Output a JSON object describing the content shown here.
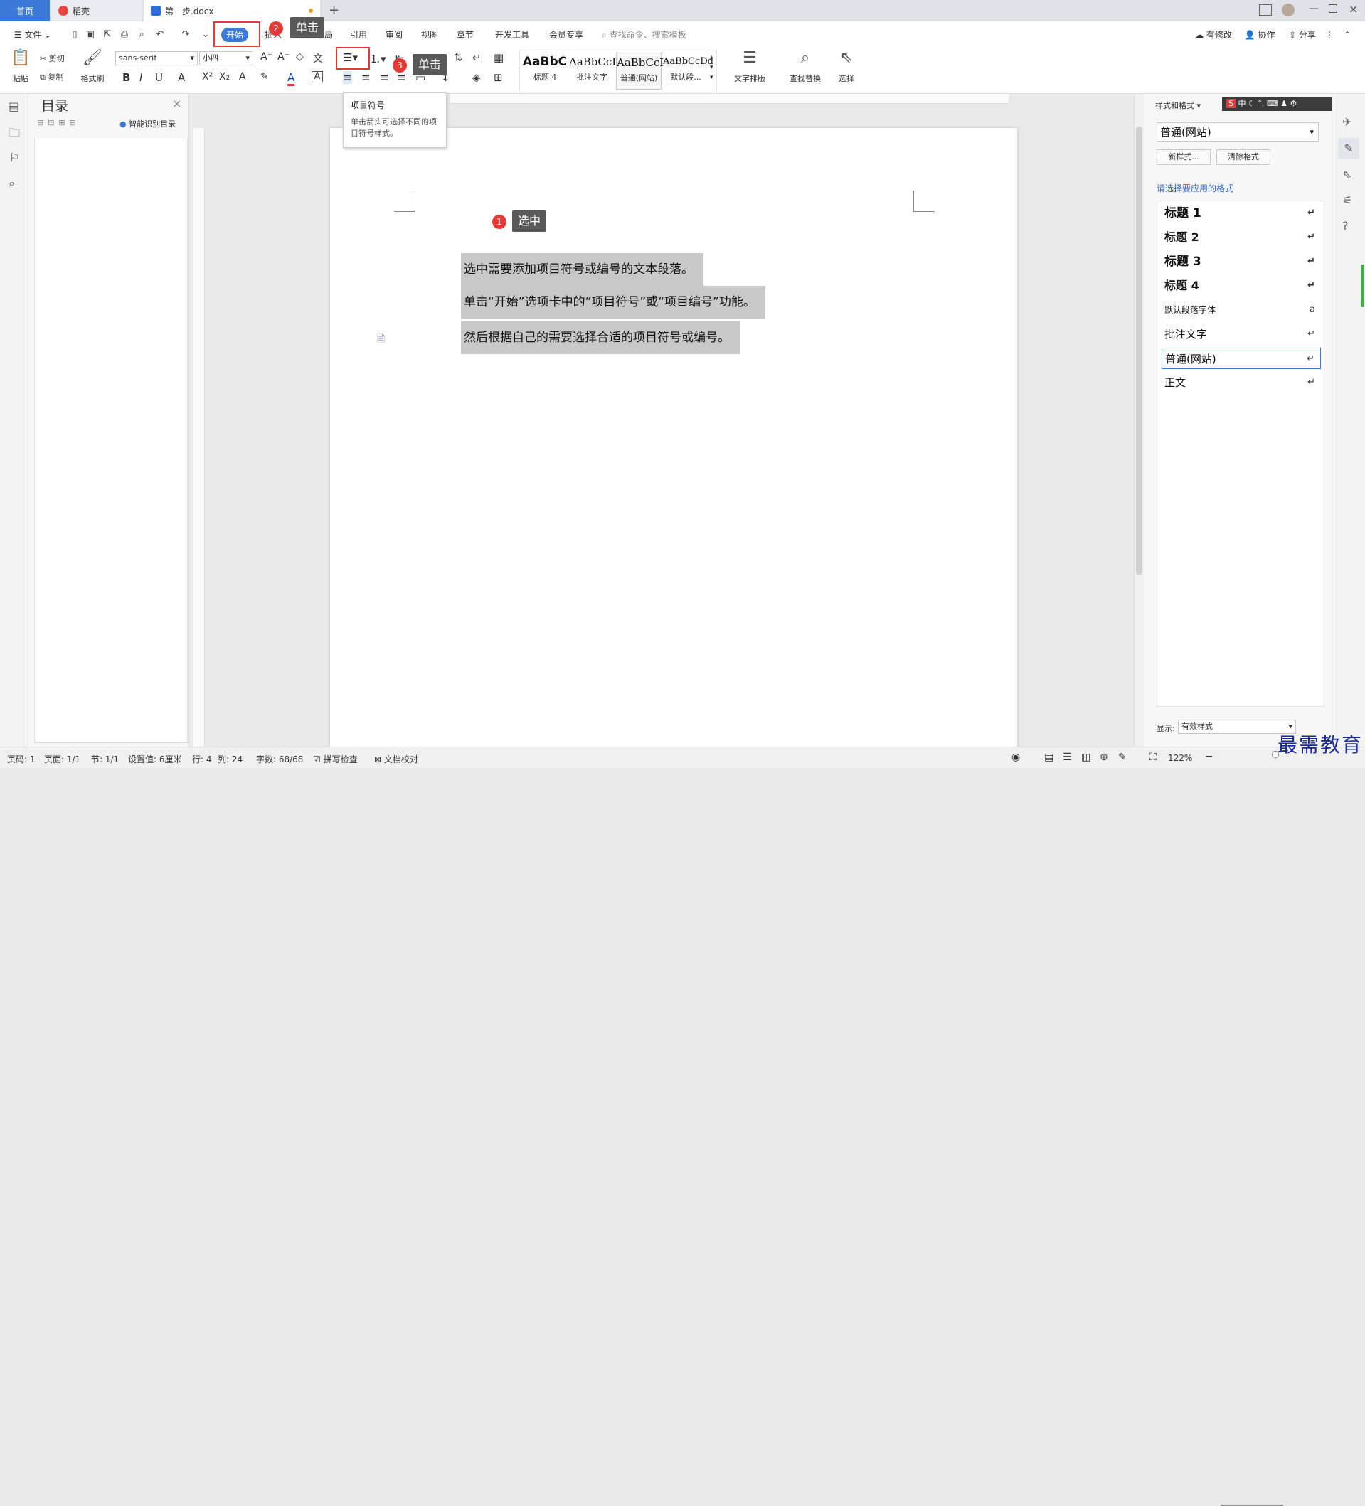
{
  "tabs": {
    "home": "首页",
    "daoke": "稻壳",
    "doc": "第一步.docx"
  },
  "menu": {
    "file": "文件",
    "items": [
      "开始",
      "插入",
      "页面布局",
      "引用",
      "审阅",
      "视图",
      "章节",
      "开发工具",
      "会员专享"
    ],
    "search": "查找命令、搜索模板",
    "right": [
      "有修改",
      "协作",
      "分享"
    ]
  },
  "ribbon": {
    "paste": "粘贴",
    "cut": "剪切",
    "copy": "复制",
    "format_painter": "格式刷",
    "font": "sans-serif",
    "size": "小四",
    "styles": [
      {
        "preview": "AaBbC",
        "label": "标题 4"
      },
      {
        "preview": "AaBbCcI",
        "label": "批注文字"
      },
      {
        "preview": "AaBbCcI",
        "label": "普通(网站)"
      },
      {
        "preview": "AaBbCcDd",
        "label": "默认段..."
      }
    ],
    "text_layout": "文字排版",
    "find_replace": "查找替换",
    "select": "选择"
  },
  "tooltip": {
    "title": "项目符号",
    "body": "单击箭头可选择不同的项目符号样式。"
  },
  "toc": {
    "title": "目录",
    "smart": "智能识别目录"
  },
  "document": {
    "paragraphs": [
      "选中需要添加项目符号或编号的文本段落。",
      "单击“开始”选项卡中的“项目符号”或“项目编号”功能。",
      "然后根据自己的需要选择合适的项目符号或编号。"
    ]
  },
  "callouts": [
    {
      "num": "1",
      "text": "选中"
    },
    {
      "num": "2",
      "text": "单击"
    },
    {
      "num": "3",
      "text": "单击"
    }
  ],
  "right_panel": {
    "header": "样式和格式",
    "current": "普通(网站)",
    "new_style": "新样式...",
    "clear_format": "清除格式",
    "prompt": "请选择要应用的格式",
    "styles": [
      "标题 1",
      "标题 2",
      "标题 3",
      "标题 4",
      "默认段落字体",
      "批注文字",
      "普通(网站)",
      "正文"
    ],
    "show_label": "显示:",
    "show_value": "有效样式"
  },
  "status": {
    "page": "页码: 1",
    "pages": "页面: 1/1",
    "section": "节: 1/1",
    "setting": "设置值: 6厘米",
    "row": "行: 4",
    "col": "列: 24",
    "words": "字数: 68/68",
    "spell": "拼写检查",
    "proof": "文档校对",
    "zoom": "122%"
  },
  "watermark": "最需教育",
  "colors": {
    "accent": "#3c7ad9",
    "callout": "#e53935",
    "selection": "#c8c8c8"
  }
}
